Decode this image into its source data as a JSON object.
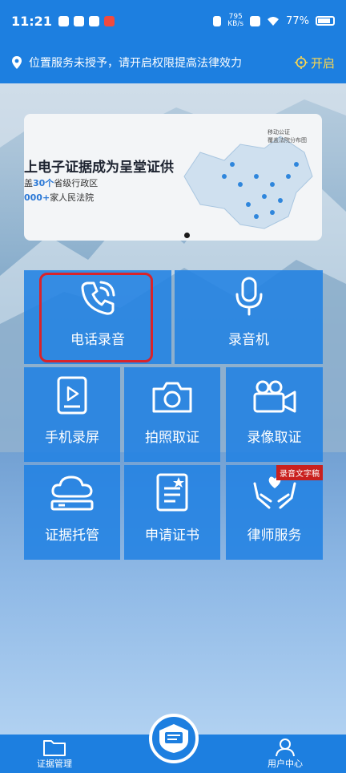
{
  "status": {
    "time": "11:21",
    "net_speed_value": "795",
    "net_speed_unit": "KB/s",
    "battery": "77%"
  },
  "location": {
    "message": "位置服务未授予，请开启权限提高法律效力",
    "enable_label": "开启"
  },
  "banner": {
    "title": "上电子证据成为呈堂证供",
    "line1_prefix": "盖",
    "line1_count": "30个",
    "line1_suffix": "省级行政区",
    "line2_count": "000+",
    "line2_suffix": "家人民法院",
    "caption_line1": "移动公证",
    "caption_line2": "覆盖法院分布图"
  },
  "tiles": [
    {
      "label": "电话录音",
      "icon": "phone-icon"
    },
    {
      "label": "录音机",
      "icon": "microphone-icon"
    },
    {
      "label": "手机录屏",
      "icon": "phone-screen-record-icon"
    },
    {
      "label": "拍照取证",
      "icon": "camera-icon"
    },
    {
      "label": "录像取证",
      "icon": "video-camera-icon"
    },
    {
      "label": "证据托管",
      "icon": "cloud-storage-icon"
    },
    {
      "label": "申请证书",
      "icon": "certificate-icon"
    },
    {
      "label": "律师服务",
      "icon": "lawyer-hands-heart-icon",
      "badge": "录音文字稿"
    }
  ],
  "bottom_nav": {
    "left_label": "证据管理",
    "right_label": "用户中心"
  },
  "colors": {
    "primary": "#1d7fe0",
    "accent": "#ffd84d",
    "highlight": "#d9232a"
  }
}
